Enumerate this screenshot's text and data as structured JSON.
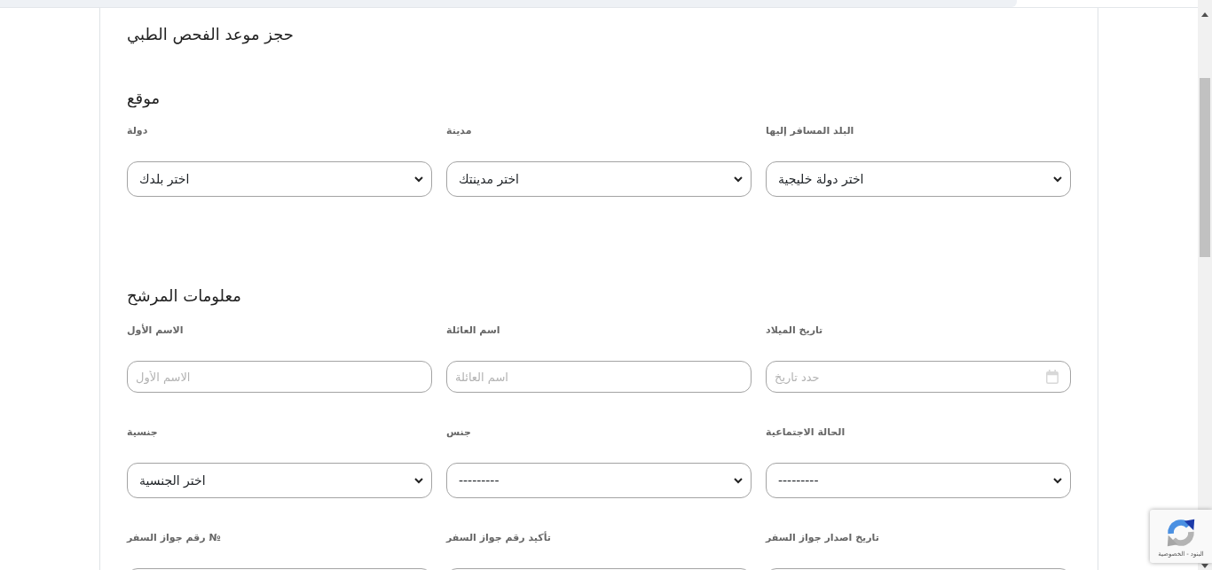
{
  "page_title": "حجز موعد الفحص الطبي",
  "sections": [
    {
      "heading": "موقع",
      "fields": [
        {
          "label": "البلد المسافر إليها",
          "kind": "select",
          "value": "اختر دولة خليجية"
        },
        {
          "label": "مدينة",
          "kind": "select",
          "value": "اختر مدينتك"
        },
        {
          "label": "دولة",
          "kind": "select",
          "value": "اختر بلدك"
        }
      ]
    },
    {
      "heading": "معلومات المرشح",
      "fields": [
        {
          "label": "تاريخ الميلاد",
          "kind": "date",
          "placeholder": "حدد تاريخ"
        },
        {
          "label": "اسم العائلة",
          "kind": "text",
          "placeholder": "اسم العائلة"
        },
        {
          "label": "الاسم الأول",
          "kind": "text",
          "placeholder": "الاسم الأول"
        },
        {
          "label": "الحالة الاجتماعية",
          "kind": "select",
          "value": "---------"
        },
        {
          "label": "جنس",
          "kind": "select",
          "value": "---------"
        },
        {
          "label": "جنسية",
          "kind": "select",
          "value": "اختر الجنسية"
        },
        {
          "label": "تاريخ اصدار جواز السفر",
          "kind": "text"
        },
        {
          "label": "تأكيد رقم جواز السفر",
          "kind": "text"
        },
        {
          "label": "رقم جواز السفر №",
          "kind": "text"
        }
      ]
    }
  ],
  "captcha_badge": {
    "links": [
      "البنود",
      "الخصوصية"
    ],
    "separator": "-"
  }
}
